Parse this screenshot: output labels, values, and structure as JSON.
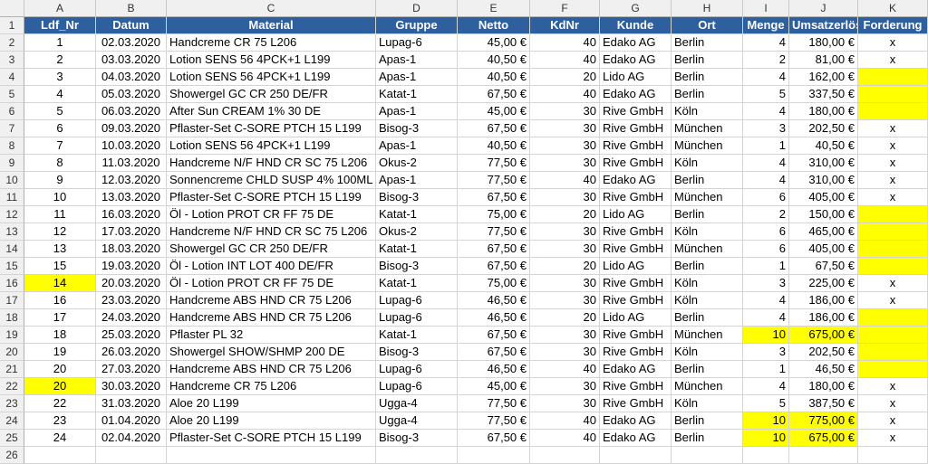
{
  "colletters": [
    "",
    "A",
    "B",
    "C",
    "D",
    "E",
    "F",
    "G",
    "H",
    "I",
    "J",
    "K"
  ],
  "headers": [
    "Ldf_Nr",
    "Datum",
    "Material",
    "Gruppe",
    "Netto",
    "KdNr",
    "Kunde",
    "Ort",
    "Menge",
    "Umsatzerlös",
    "Forderung"
  ],
  "highlight_color": "#ffff00",
  "header_color": "#2e5f9e",
  "rows": [
    {
      "n": "2",
      "ldf": "1",
      "datum": "02.03.2020",
      "material": "Handcreme CR 75 L206",
      "gruppe": "Lupag-6",
      "netto": "45,00 €",
      "kdnr": "40",
      "kunde": "Edako AG",
      "ort": "Berlin",
      "menge": "4",
      "umsatz": "180,00 €",
      "ford": "x"
    },
    {
      "n": "3",
      "ldf": "2",
      "datum": "03.03.2020",
      "material": "Lotion SENS 56 4PCK+1 L199",
      "gruppe": "Apas-1",
      "netto": "40,50 €",
      "kdnr": "40",
      "kunde": "Edako AG",
      "ort": "Berlin",
      "menge": "2",
      "umsatz": "81,00 €",
      "ford": "x"
    },
    {
      "n": "4",
      "ldf": "3",
      "datum": "04.03.2020",
      "material": "Lotion SENS 56 4PCK+1 L199",
      "gruppe": "Apas-1",
      "netto": "40,50 €",
      "kdnr": "20",
      "kunde": "Lido AG",
      "ort": "Berlin",
      "menge": "4",
      "umsatz": "162,00 €",
      "ford": ""
    },
    {
      "n": "5",
      "ldf": "4",
      "datum": "05.03.2020",
      "material": "Showergel GC CR 250 DE/FR",
      "gruppe": "Katat-1",
      "netto": "67,50 €",
      "kdnr": "40",
      "kunde": "Edako AG",
      "ort": "Berlin",
      "menge": "5",
      "umsatz": "337,50 €",
      "ford": ""
    },
    {
      "n": "6",
      "ldf": "5",
      "datum": "06.03.2020",
      "material": "After Sun CREAM 1% 30 DE",
      "gruppe": "Apas-1",
      "netto": "45,00 €",
      "kdnr": "30",
      "kunde": "Rive GmbH",
      "ort": "Köln",
      "menge": "4",
      "umsatz": "180,00 €",
      "ford": ""
    },
    {
      "n": "7",
      "ldf": "6",
      "datum": "09.03.2020",
      "material": "Pflaster-Set C-SORE PTCH 15 L199",
      "gruppe": "Bisog-3",
      "netto": "67,50 €",
      "kdnr": "30",
      "kunde": "Rive GmbH",
      "ort": "München",
      "menge": "3",
      "umsatz": "202,50 €",
      "ford": "x"
    },
    {
      "n": "8",
      "ldf": "7",
      "datum": "10.03.2020",
      "material": "Lotion SENS 56 4PCK+1 L199",
      "gruppe": "Apas-1",
      "netto": "40,50 €",
      "kdnr": "30",
      "kunde": "Rive GmbH",
      "ort": "München",
      "menge": "1",
      "umsatz": "40,50 €",
      "ford": "x"
    },
    {
      "n": "9",
      "ldf": "8",
      "datum": "11.03.2020",
      "material": "Handcreme N/F HND CR SC 75 L206",
      "gruppe": "Okus-2",
      "netto": "77,50 €",
      "kdnr": "30",
      "kunde": "Rive GmbH",
      "ort": "Köln",
      "menge": "4",
      "umsatz": "310,00 €",
      "ford": "x"
    },
    {
      "n": "10",
      "ldf": "9",
      "datum": "12.03.2020",
      "material": "Sonnencreme CHLD SUSP 4% 100ML DE",
      "gruppe": "Apas-1",
      "netto": "77,50 €",
      "kdnr": "40",
      "kunde": "Edako AG",
      "ort": "Berlin",
      "menge": "4",
      "umsatz": "310,00 €",
      "ford": "x"
    },
    {
      "n": "11",
      "ldf": "10",
      "datum": "13.03.2020",
      "material": "Pflaster-Set C-SORE PTCH 15 L199",
      "gruppe": "Bisog-3",
      "netto": "67,50 €",
      "kdnr": "30",
      "kunde": "Rive GmbH",
      "ort": "München",
      "menge": "6",
      "umsatz": "405,00 €",
      "ford": "x"
    },
    {
      "n": "12",
      "ldf": "11",
      "datum": "16.03.2020",
      "material": "Öl - Lotion PROT CR FF 75 DE",
      "gruppe": "Katat-1",
      "netto": "75,00 €",
      "kdnr": "20",
      "kunde": "Lido AG",
      "ort": "Berlin",
      "menge": "2",
      "umsatz": "150,00 €",
      "ford": ""
    },
    {
      "n": "13",
      "ldf": "12",
      "datum": "17.03.2020",
      "material": "Handcreme N/F HND CR SC 75 L206",
      "gruppe": "Okus-2",
      "netto": "77,50 €",
      "kdnr": "30",
      "kunde": "Rive GmbH",
      "ort": "Köln",
      "menge": "6",
      "umsatz": "465,00 €",
      "ford": ""
    },
    {
      "n": "14",
      "ldf": "13",
      "datum": "18.03.2020",
      "material": "Showergel GC CR 250 DE/FR",
      "gruppe": "Katat-1",
      "netto": "67,50 €",
      "kdnr": "30",
      "kunde": "Rive GmbH",
      "ort": "München",
      "menge": "6",
      "umsatz": "405,00 €",
      "ford": ""
    },
    {
      "n": "15",
      "ldf": "15",
      "datum": "19.03.2020",
      "material": "Öl - Lotion INT LOT 400 DE/FR",
      "gruppe": "Bisog-3",
      "netto": "67,50 €",
      "kdnr": "20",
      "kunde": "Lido AG",
      "ort": "Berlin",
      "menge": "1",
      "umsatz": "67,50 €",
      "ford": ""
    },
    {
      "n": "16",
      "ldf": "14",
      "datum": "20.03.2020",
      "material": "Öl - Lotion PROT CR FF 75 DE",
      "gruppe": "Katat-1",
      "netto": "75,00 €",
      "kdnr": "30",
      "kunde": "Rive GmbH",
      "ort": "Köln",
      "menge": "3",
      "umsatz": "225,00 €",
      "ford": "x"
    },
    {
      "n": "17",
      "ldf": "16",
      "datum": "23.03.2020",
      "material": "Handcreme ABS HND CR 75 L206",
      "gruppe": "Lupag-6",
      "netto": "46,50 €",
      "kdnr": "30",
      "kunde": "Rive GmbH",
      "ort": "Köln",
      "menge": "4",
      "umsatz": "186,00 €",
      "ford": "x"
    },
    {
      "n": "18",
      "ldf": "17",
      "datum": "24.03.2020",
      "material": "Handcreme ABS HND CR 75 L206",
      "gruppe": "Lupag-6",
      "netto": "46,50 €",
      "kdnr": "20",
      "kunde": "Lido AG",
      "ort": "Berlin",
      "menge": "4",
      "umsatz": "186,00 €",
      "ford": ""
    },
    {
      "n": "19",
      "ldf": "18",
      "datum": "25.03.2020",
      "material": "Pflaster PL 32",
      "gruppe": "Katat-1",
      "netto": "67,50 €",
      "kdnr": "30",
      "kunde": "Rive GmbH",
      "ort": "München",
      "menge": "10",
      "umsatz": "675,00 €",
      "ford": ""
    },
    {
      "n": "20",
      "ldf": "19",
      "datum": "26.03.2020",
      "material": "Showergel SHOW/SHMP 200 DE",
      "gruppe": "Bisog-3",
      "netto": "67,50 €",
      "kdnr": "30",
      "kunde": "Rive GmbH",
      "ort": "Köln",
      "menge": "3",
      "umsatz": "202,50 €",
      "ford": ""
    },
    {
      "n": "21",
      "ldf": "20",
      "datum": "27.03.2020",
      "material": "Handcreme ABS HND CR 75 L206",
      "gruppe": "Lupag-6",
      "netto": "46,50 €",
      "kdnr": "40",
      "kunde": "Edako AG",
      "ort": "Berlin",
      "menge": "1",
      "umsatz": "46,50 €",
      "ford": ""
    },
    {
      "n": "22",
      "ldf": "20",
      "datum": "30.03.2020",
      "material": "Handcreme CR 75 L206",
      "gruppe": "Lupag-6",
      "netto": "45,00 €",
      "kdnr": "30",
      "kunde": "Rive GmbH",
      "ort": "München",
      "menge": "4",
      "umsatz": "180,00 €",
      "ford": "x"
    },
    {
      "n": "23",
      "ldf": "22",
      "datum": "31.03.2020",
      "material": "Aloe 20 L199",
      "gruppe": "Ugga-4",
      "netto": "77,50 €",
      "kdnr": "30",
      "kunde": "Rive GmbH",
      "ort": "Köln",
      "menge": "5",
      "umsatz": "387,50 €",
      "ford": "x"
    },
    {
      "n": "24",
      "ldf": "23",
      "datum": "01.04.2020",
      "material": "Aloe 20 L199",
      "gruppe": "Ugga-4",
      "netto": "77,50 €",
      "kdnr": "40",
      "kunde": "Edako AG",
      "ort": "Berlin",
      "menge": "10",
      "umsatz": "775,00 €",
      "ford": "x"
    },
    {
      "n": "25",
      "ldf": "24",
      "datum": "02.04.2020",
      "material": "Pflaster-Set C-SORE PTCH 15 L199",
      "gruppe": "Bisog-3",
      "netto": "67,50 €",
      "kdnr": "40",
      "kunde": "Edako AG",
      "ort": "Berlin",
      "menge": "10",
      "umsatz": "675,00 €",
      "ford": "x"
    }
  ],
  "highlights": [
    {
      "row": "4",
      "col": "ford"
    },
    {
      "row": "5",
      "col": "ford"
    },
    {
      "row": "6",
      "col": "ford"
    },
    {
      "row": "12",
      "col": "ford"
    },
    {
      "row": "13",
      "col": "ford"
    },
    {
      "row": "14",
      "col": "ford"
    },
    {
      "row": "15",
      "col": "ford"
    },
    {
      "row": "16",
      "col": "ldf"
    },
    {
      "row": "18",
      "col": "ford"
    },
    {
      "row": "19",
      "col": "ford"
    },
    {
      "row": "20",
      "col": "ford"
    },
    {
      "row": "21",
      "col": "ford"
    },
    {
      "row": "19",
      "col": "menge"
    },
    {
      "row": "19",
      "col": "umsatz"
    },
    {
      "row": "22",
      "col": "ldf"
    },
    {
      "row": "24",
      "col": "menge"
    },
    {
      "row": "24",
      "col": "umsatz"
    },
    {
      "row": "25",
      "col": "menge"
    },
    {
      "row": "25",
      "col": "umsatz"
    }
  ],
  "extra_rows": [
    "26"
  ]
}
